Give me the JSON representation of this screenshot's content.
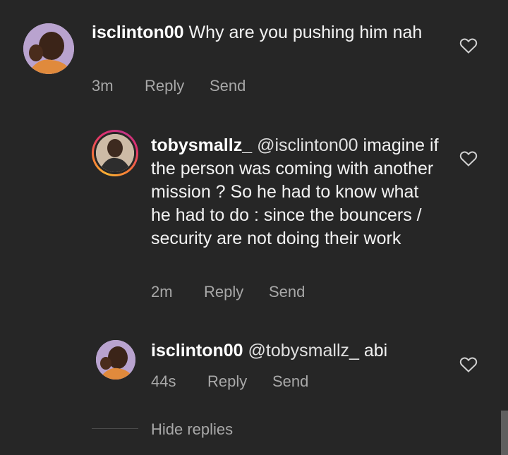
{
  "comments": [
    {
      "username": "isclinton00",
      "text": "Why are you pushing him nah",
      "time": "3m",
      "reply_label": "Reply",
      "send_label": "Send",
      "avatar": "profile-photo",
      "liked": false
    },
    {
      "username": "tobysmallz_",
      "mention": "@isclinton00",
      "text": "imagine if the person was coming with another mission ? So he had to know what he had to do : since the bouncers / security are not doing their work",
      "time": "2m",
      "reply_label": "Reply",
      "send_label": "Send",
      "avatar": "profile-photo-with-story-ring",
      "liked": false
    },
    {
      "username": "isclinton00",
      "mention": "@tobysmallz_",
      "text": "abi",
      "time": "44s",
      "reply_label": "Reply",
      "send_label": "Send",
      "avatar": "profile-photo",
      "liked": false
    }
  ],
  "hide_replies_label": "Hide replies",
  "colors": {
    "background": "#262626",
    "text": "#ffffff",
    "meta": "#a8a8a8"
  },
  "icons": {
    "like": "heart-outline-icon"
  }
}
